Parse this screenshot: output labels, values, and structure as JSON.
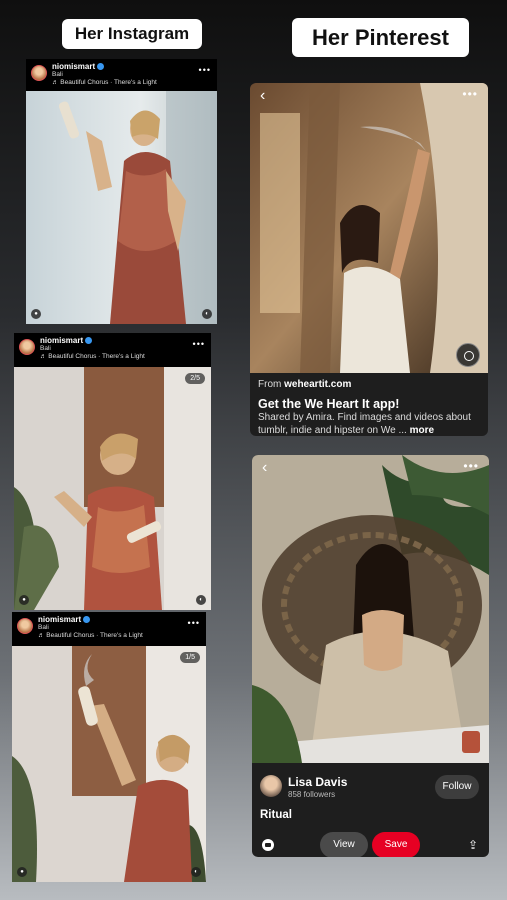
{
  "labels": {
    "instagram": "Her Instagram",
    "pinterest": "Her Pinterest"
  },
  "instagram_posts": [
    {
      "username": "niomismart",
      "location": "Bali",
      "music": "♬ Beautiful Chorus · There's a Light",
      "counter": ""
    },
    {
      "username": "niomismart",
      "location": "Bali",
      "music": "♬ Beautiful Chorus · There's a Light",
      "counter": "2/5"
    },
    {
      "username": "niomismart",
      "location": "Bali",
      "music": "♬ Beautiful Chorus · There's a Light",
      "counter": "1/5"
    }
  ],
  "pinterest_pins": [
    {
      "from_prefix": "From ",
      "from_site": "weheartit.com",
      "title": "Get the We Heart It app!",
      "description": "Shared by Amira. Find images and videos about tumblr, indie and hipster on We ...",
      "more": "more"
    },
    {
      "author": "Lisa Davis",
      "followers": "858 followers",
      "follow_label": "Follow",
      "board": "Ritual",
      "view_label": "View",
      "save_label": "Save"
    }
  ],
  "icons": {
    "more": "•••",
    "back": "‹",
    "share": "⇪",
    "user": "●",
    "sound": "◐"
  },
  "colors": {
    "pinterest_red": "#e60023",
    "instagram_verified": "#3897f0"
  }
}
